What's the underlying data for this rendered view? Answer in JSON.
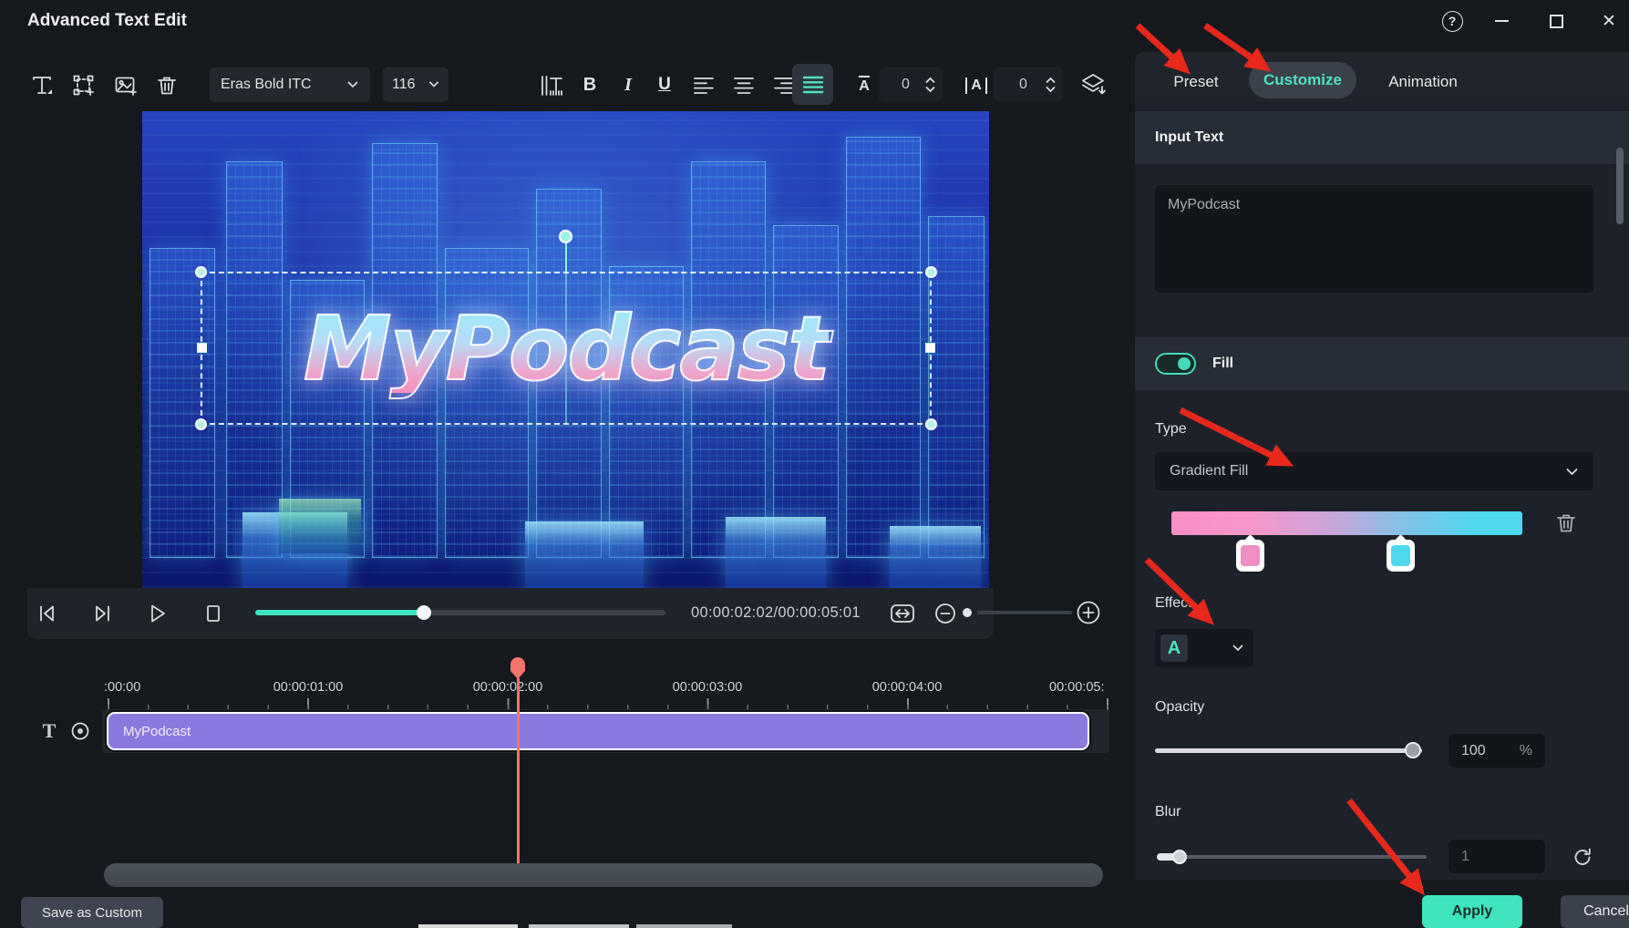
{
  "window": {
    "title": "Advanced Text Edit"
  },
  "icons": {
    "help": "?",
    "close": "✕",
    "bold": "B",
    "italic": "I",
    "underline": "U",
    "char_a": "A",
    "track_text": "T"
  },
  "toolbar": {
    "font_family": "Eras Bold ITC",
    "font_size": "116",
    "char_spacing": "0",
    "line_spacing": "0"
  },
  "tabs": {
    "preset": "Preset",
    "customize": "Customize",
    "animation": "Animation"
  },
  "panel": {
    "input_text_header": "Input Text",
    "input_text_value": "MyPodcast",
    "fill_label": "Fill",
    "type_label": "Type",
    "type_value": "Gradient Fill",
    "gradient": {
      "start_color": "#f98fc5",
      "end_color": "#4dd8ee"
    },
    "effect_label": "Effect",
    "effect_swatch": "A",
    "opacity_label": "Opacity",
    "opacity_value": "100",
    "opacity_unit": "%",
    "blur_label": "Blur",
    "blur_value": "1",
    "apply_label": "Apply",
    "cancel_label": "Cancel",
    "accent_color": "#3fe3bd"
  },
  "preview": {
    "text": "MyPodcast"
  },
  "playback": {
    "time": "00:00:02:02/00:00:05:01"
  },
  "timeline": {
    "ruler_labels": [
      ":00:00",
      "00:00:01:00",
      "00:00:02:00",
      "00:00:03:00",
      "00:00:04:00",
      "00:00:05:"
    ],
    "clip_label": "MyPodcast"
  },
  "footer": {
    "save_as_custom": "Save as Custom"
  }
}
